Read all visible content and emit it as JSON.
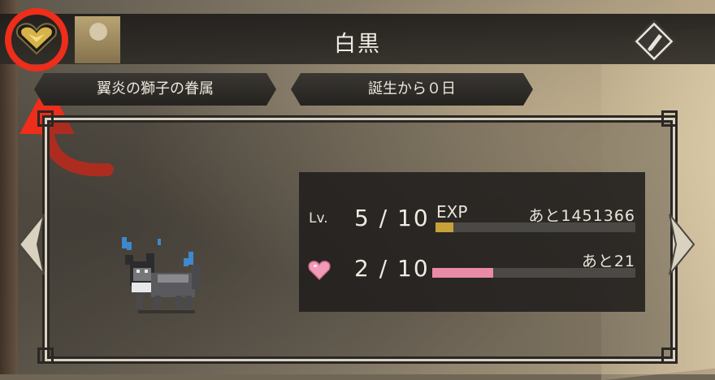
{
  "pet": {
    "name": "白黒",
    "species": "翼炎の獅子の眷属",
    "birth": "誕生から０日"
  },
  "level": {
    "label": "Lv.",
    "value": "5 / 10",
    "exp_label": "EXP",
    "exp_remaining": "あと1451366",
    "exp_progress": 0.09
  },
  "affection": {
    "value": "2 / 10",
    "remaining": "あと21",
    "progress": 0.3
  },
  "icons": {
    "badge": "heart-badge-icon",
    "edit": "edit-pen-icon",
    "nav_left": "left-arrow-icon",
    "nav_right": "right-arrow-icon",
    "affection": "pink-heart-icon"
  },
  "colors": {
    "annotation": "#ee2d1b",
    "exp_bar": "#c9a13a",
    "affection_bar": "#e98aa6",
    "gold": "#d7b24a"
  }
}
